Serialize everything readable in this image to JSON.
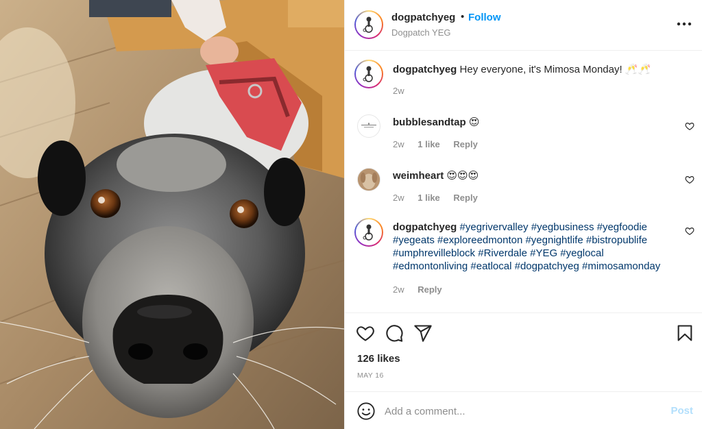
{
  "post": {
    "username": "dogpatchyeg",
    "separator": "•",
    "follow_label": "Follow",
    "location": "Dogpatch YEG"
  },
  "comments": [
    {
      "username": "dogpatchyeg",
      "text": "Hey everyone, it's Mimosa Monday! 🥂🥂",
      "age": "2w"
    },
    {
      "username": "bubblesandtap",
      "text": "😍",
      "age": "2w",
      "likes": "1 like",
      "reply": "Reply"
    },
    {
      "username": "weimheart",
      "text": "😍😍😍",
      "age": "2w",
      "likes": "1 like",
      "reply": "Reply"
    },
    {
      "username": "dogpatchyeg",
      "hashtags": "#yegrivervalley #yegbusiness #yegfoodie #yegeats #exploreedmonton #yegnightlife #bistropublife #umphrevilleblock #Riverdale #YEG #yeglocal #edmontonliving #eatlocal #dogpatchyeg #mimosamonday",
      "age": "2w",
      "reply": "Reply"
    }
  ],
  "likes_text": "126 likes",
  "date_text": "MAY 16",
  "add_comment": {
    "placeholder": "Add a comment...",
    "post_label": "Post"
  },
  "icons": {
    "more": "more-options-icon",
    "like": "heart-icon",
    "comment": "comment-bubble-icon",
    "share": "paper-plane-icon",
    "save": "bookmark-icon",
    "emoji": "smiley-face-icon"
  },
  "colors": {
    "link_blue": "#0095f6",
    "hashtag_blue": "#00376b",
    "muted": "#8e8e8e",
    "post_disabled": "#b2dffc"
  }
}
